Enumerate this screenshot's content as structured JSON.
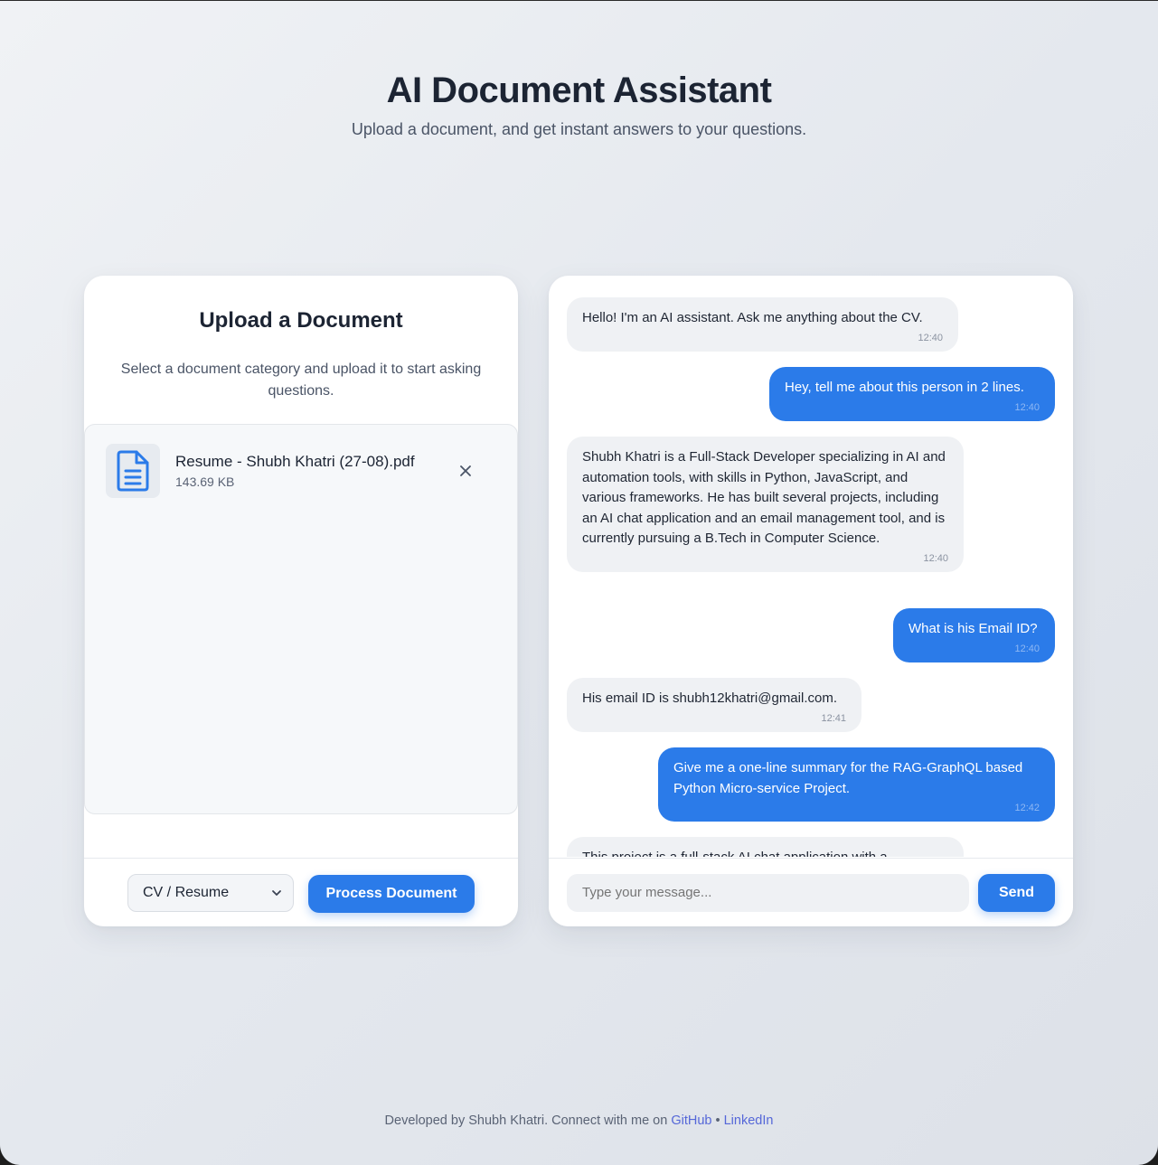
{
  "header": {
    "title": "AI Document Assistant",
    "subtitle": "Upload a document, and get instant answers to your questions."
  },
  "upload": {
    "title": "Upload a Document",
    "description": "Select a document category and upload it to start asking questions.",
    "file": {
      "name": "Resume - Shubh Khatri (27-08).pdf",
      "size": "143.69 KB",
      "icon": "document-icon"
    },
    "category": {
      "selected": "CV / Resume"
    },
    "process_label": "Process Document"
  },
  "chat": {
    "messages": [
      {
        "role": "bot",
        "text": "Hello! I'm an AI assistant. Ask me anything about the CV.",
        "time": "12:40"
      },
      {
        "role": "user",
        "text": "Hey, tell me about this person in 2 lines.",
        "time": "12:40"
      },
      {
        "role": "bot",
        "text": "Shubh Khatri is a Full-Stack Developer specializing in AI and automation tools, with skills in Python, JavaScript, and various frameworks. He has built several projects, including an AI chat application and an email management tool, and is currently pursuing a B.Tech in Computer Science.",
        "time": "12:40"
      },
      {
        "role": "user",
        "text": "What is his Email ID?",
        "time": "12:40"
      },
      {
        "role": "bot",
        "text": "His email ID is shubh12khatri@gmail.com.",
        "time": "12:41"
      },
      {
        "role": "user",
        "text": "Give me a one-line summary for the RAG-GraphQL based Python Micro-service Project.",
        "time": "12:42"
      },
      {
        "role": "bot",
        "text": "This project is a full-stack AI chat application with a",
        "time": ""
      }
    ],
    "input_placeholder": "Type your message...",
    "send_label": "Send"
  },
  "footer": {
    "text": "Developed by Shubh Khatri. Connect with me on",
    "github": "GitHub",
    "separator": "•",
    "linkedin": "LinkedIn"
  },
  "colors": {
    "accent": "#2b7be9",
    "link": "#5567d8",
    "text_dark": "#1c2433"
  }
}
